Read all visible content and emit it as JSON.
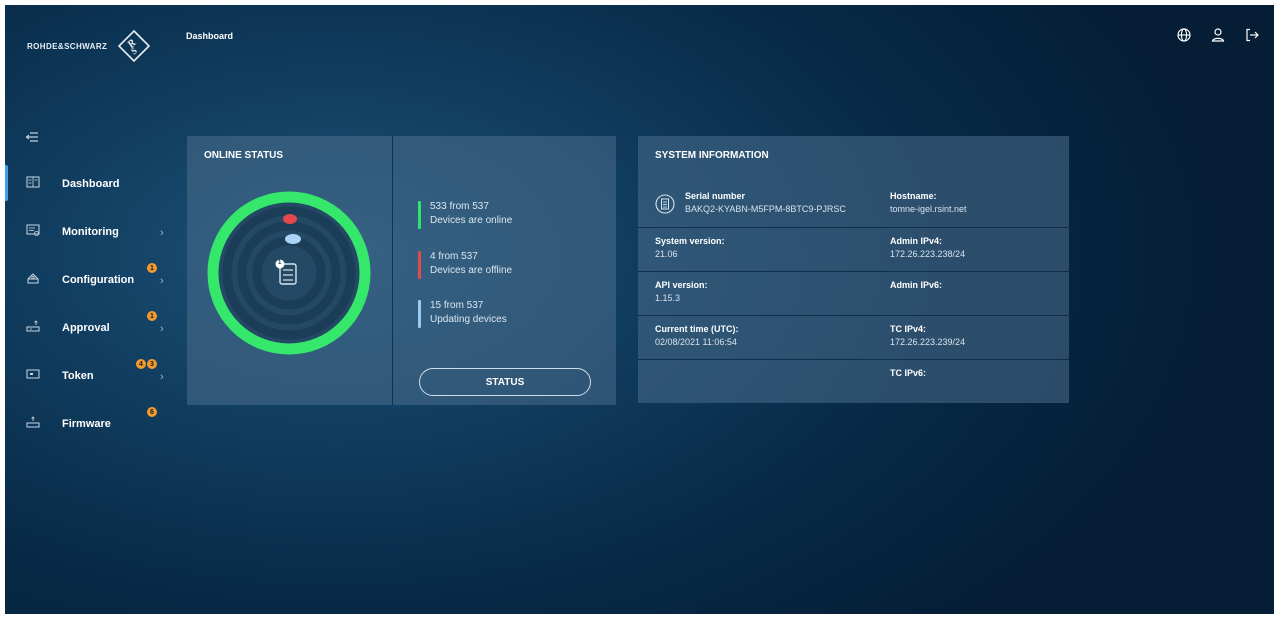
{
  "brand": {
    "name": "ROHDE&SCHWARZ"
  },
  "header": {
    "title": "Dashboard",
    "icons": [
      "globe-icon",
      "user-icon",
      "logout-icon"
    ]
  },
  "sidebar": {
    "collapse_icon": "collapse-menu-icon",
    "items": [
      {
        "label": "Dashboard",
        "icon": "dashboard-icon",
        "active": true,
        "badges": []
      },
      {
        "label": "Monitoring",
        "icon": "monitoring-icon",
        "chevron": "›",
        "badges": []
      },
      {
        "label": "Configuration",
        "icon": "configuration-icon",
        "chevron": "›",
        "badges": [
          "1"
        ]
      },
      {
        "label": "Approval",
        "icon": "approval-icon",
        "chevron": "›",
        "badges": [
          "1"
        ]
      },
      {
        "label": "Token",
        "icon": "token-icon",
        "chevron": "›",
        "badges": [
          "4",
          "3"
        ]
      },
      {
        "label": "Firmware",
        "icon": "firmware-icon",
        "badges": [
          "6"
        ]
      }
    ]
  },
  "online_status": {
    "title": "ONLINE STATUS",
    "center_badge": "1",
    "legend": [
      {
        "count": "533 from 537",
        "label": "Devices are online",
        "color": "#2ee56b"
      },
      {
        "count": "4 from 537",
        "label": "Devices are offline",
        "color": "#e04b4b"
      },
      {
        "count": "15 from 537",
        "label": "Updating devices",
        "color": "#9cc9f0"
      }
    ],
    "button_label": "STATUS"
  },
  "system_info": {
    "title": "SYSTEM INFORMATION",
    "serial_label": "Serial number",
    "serial_value": "BAKQ2-KYABN-M5FPM-8BTC9-PJRSC",
    "hostname_label": "Hostname:",
    "hostname_value": "tomne-igel.rsint.net",
    "system_version_label": "System version:",
    "system_version_value": "21.06",
    "admin_ipv4_label": "Admin IPv4:",
    "admin_ipv4_value": "172.26.223.238/24",
    "api_version_label": "API version:",
    "api_version_value": "1.15.3",
    "admin_ipv6_label": "Admin IPv6:",
    "admin_ipv6_value": "",
    "current_time_label": "Current time (UTC):",
    "current_time_value": "02/08/2021 11:06:54",
    "tc_ipv4_label": "TC IPv4:",
    "tc_ipv4_value": "172.26.223.239/24",
    "tc_ipv6_label": "TC IPv6:",
    "tc_ipv6_value": ""
  }
}
